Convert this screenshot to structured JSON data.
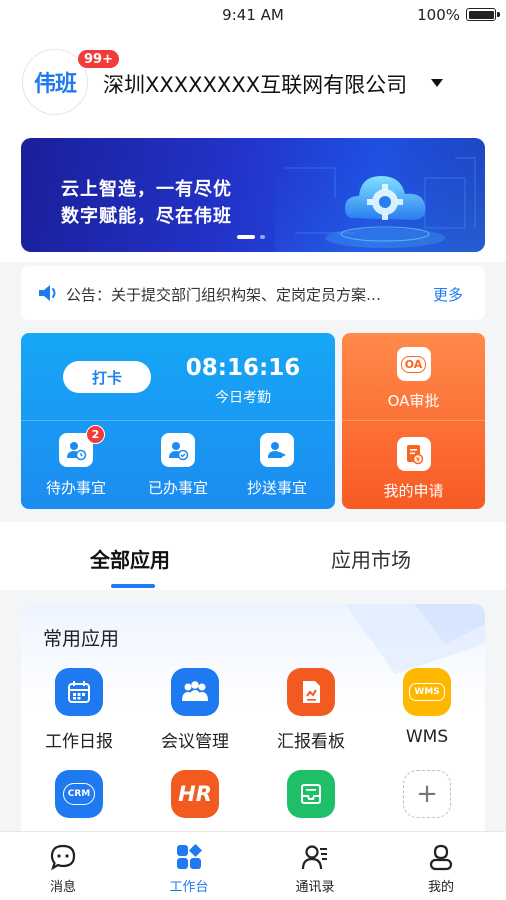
{
  "status_bar": {
    "time": "9:41 AM",
    "battery": "100%",
    "battery_level": 1.0
  },
  "header": {
    "logo_text": "伟班",
    "badge": "99+",
    "company": "深圳XXXXXXXX互联网有限公司"
  },
  "banner": {
    "line1": "云上智造，一有尽优",
    "line2": "数字赋能，尽在伟班",
    "slides": 2,
    "active_slide": 1
  },
  "notice": {
    "text": "公告：关于提交部门组织构架、定岗定员方案…",
    "more": "更多"
  },
  "attendance": {
    "clock_button": "打卡",
    "time": "08:16:16",
    "time_label": "今日考勤",
    "items": [
      {
        "label": "待办事宜",
        "badge": "2",
        "icon": "todo-icon"
      },
      {
        "label": "已办事宜",
        "badge": "",
        "icon": "done-icon"
      },
      {
        "label": "抄送事宜",
        "badge": "",
        "icon": "cc-icon"
      }
    ]
  },
  "oa": {
    "items": [
      {
        "label": "OA审批",
        "icon": "oa-icon",
        "icon_text": "OA"
      },
      {
        "label": "我的申请",
        "icon": "my-application-icon"
      }
    ]
  },
  "tabs": [
    {
      "label": "全部应用",
      "active": true
    },
    {
      "label": "应用市场",
      "active": false
    }
  ],
  "apps": {
    "title": "常用应用",
    "items": [
      {
        "label": "工作日报",
        "icon": "calendar-icon",
        "color": "#1f7af2"
      },
      {
        "label": "会议管理",
        "icon": "meeting-icon",
        "color": "#1f7af2"
      },
      {
        "label": "汇报看板",
        "icon": "report-icon",
        "color": "#f25a1f"
      },
      {
        "label": "WMS",
        "icon": "wms-icon",
        "icon_text": "WMS",
        "color": "#ffb800"
      },
      {
        "label": "",
        "icon": "crm-icon",
        "icon_text": "CRM",
        "color": "#1f7af2"
      },
      {
        "label": "",
        "icon": "hr-icon",
        "icon_text": "HR",
        "color": "#f25a1f"
      },
      {
        "label": "",
        "icon": "inbox-icon",
        "color": "#1fbf6a"
      },
      {
        "label": "",
        "icon": "add-icon",
        "icon_text": "+",
        "color": "#ffffff"
      }
    ]
  },
  "bottom_nav": [
    {
      "label": "消息",
      "icon": "message-icon",
      "active": false
    },
    {
      "label": "工作台",
      "icon": "workbench-icon",
      "active": true
    },
    {
      "label": "通讯录",
      "icon": "contacts-icon",
      "active": false
    },
    {
      "label": "我的",
      "icon": "profile-icon",
      "active": false
    }
  ]
}
